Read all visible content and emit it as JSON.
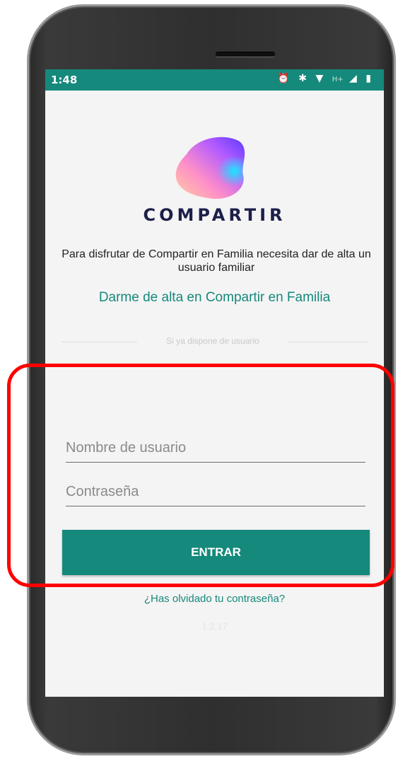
{
  "status_bar": {
    "time": "1:48",
    "icons": [
      "alarm-icon",
      "bluetooth-icon",
      "wifi-icon",
      "signal-icon",
      "battery-icon"
    ],
    "network_label": "H+"
  },
  "app": {
    "brand_name": "COMPARTIR",
    "intro_text": "Para disfrutar de Compartir en Familia necesita dar de alta un usuario familiar",
    "signup_link": "Darme de alta en Compartir en Familia",
    "divider_text": "Si ya dispone de usuario",
    "username_placeholder": "Nombre de usuario",
    "password_placeholder": "Contraseña",
    "enter_button": "ENTRAR",
    "forgot_link": "¿Has olvidado tu contraseña?",
    "version": "1.2.17"
  },
  "colors": {
    "accent": "#15897b",
    "brand_text": "#1d1f4a",
    "highlight": "#ff0000"
  }
}
